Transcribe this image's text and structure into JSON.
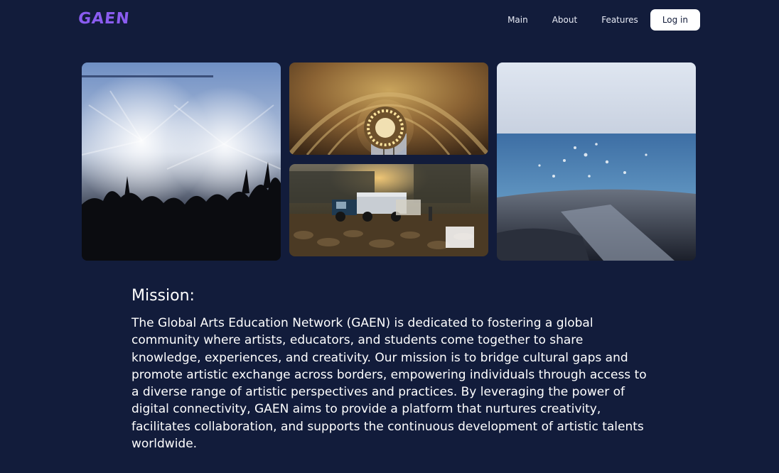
{
  "header": {
    "logo": "GAEN",
    "nav": [
      {
        "label": "Main"
      },
      {
        "label": "About"
      },
      {
        "label": "Features"
      }
    ],
    "login_label": "Log in"
  },
  "gallery": {
    "images": [
      {
        "icon": "concert-photo"
      },
      {
        "icon": "ornate-ceiling-photo"
      },
      {
        "icon": "truck-field-photo"
      },
      {
        "icon": "sea-view-photo"
      }
    ]
  },
  "mission": {
    "title": "Mission:",
    "body": "The Global Arts Education Network (GAEN) is dedicated to fostering a global community where artists, educators, and students come together to share knowledge, experiences, and creativity. Our mission is to bridge cultural gaps and promote artistic exchange across borders, empowering individuals through access to a diverse range of artistic perspectives and practices. By leveraging the power of digital connectivity, GAEN aims to provide a platform that nurtures creativity, facilitates collaboration, and supports the continuous development of artistic talents worldwide."
  },
  "colors": {
    "background": "#121c3b",
    "logo": "#8a5cf0",
    "button_bg": "#ffffff",
    "button_text": "#101a38"
  }
}
